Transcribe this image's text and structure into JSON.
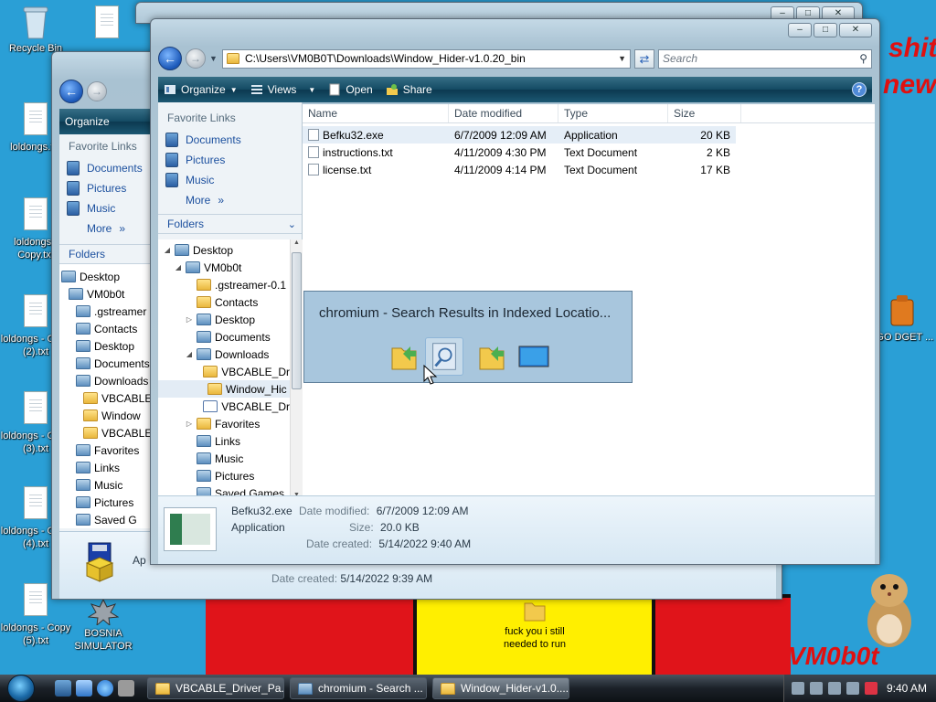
{
  "desktop": {
    "icons": [
      {
        "label": "Recycle Bin"
      },
      {
        "label": ""
      },
      {
        "label": "loldongs.txt"
      },
      {
        "label": "loldongs - Copy.txt"
      },
      {
        "label": "loldongs - Copy (2).txt"
      },
      {
        "label": "loldongs - Copy (3).txt"
      },
      {
        "label": "loldongs - Copy (4).txt"
      },
      {
        "label": "loldongs - Copy (5).txt"
      },
      {
        "label": "BOSNIA SIMULATOR"
      },
      {
        "label": "fuck you i still needed to run"
      },
      {
        "label": "O GO DGET ..."
      }
    ],
    "wallpaper_text": [
      "shit",
      "new",
      "VM0b0t"
    ]
  },
  "back_window": {
    "organize": "Organize",
    "favorite_links_title": "Favorite Links",
    "favorites": [
      "Documents",
      "Pictures",
      "Music"
    ],
    "more": "More",
    "folders_title": "Folders",
    "tree": [
      "Desktop",
      "VM0b0t",
      ".gstreamer",
      "Contacts",
      "Desktop",
      "Documents",
      "Downloads",
      "VBCABLE",
      "Window",
      "VBCABLE",
      "Favorites",
      "Links",
      "Music",
      "Pictures",
      "Saved G"
    ],
    "details_fragment": "Ap",
    "date_created_label": "Date created:",
    "date_created_value": "5/14/2022 9:39 AM"
  },
  "main_window": {
    "address": "C:\\Users\\VM0B0T\\Downloads\\Window_Hider-v1.0.20_bin",
    "search_placeholder": "Search",
    "toolbar": {
      "organize": "Organize",
      "views": "Views",
      "open": "Open",
      "share": "Share"
    },
    "favorite_links_title": "Favorite Links",
    "favorites": [
      "Documents",
      "Pictures",
      "Music"
    ],
    "more": "More",
    "folders_title": "Folders",
    "tree": [
      {
        "label": "Desktop",
        "level": 0,
        "expand": "open",
        "icon": "blue"
      },
      {
        "label": "VM0b0t",
        "level": 1,
        "expand": "open",
        "icon": "blue"
      },
      {
        "label": ".gstreamer-0.1",
        "level": 2,
        "expand": "",
        "icon": "folder"
      },
      {
        "label": "Contacts",
        "level": 2,
        "expand": "",
        "icon": "folder"
      },
      {
        "label": "Desktop",
        "level": 2,
        "expand": "closed",
        "icon": "blue"
      },
      {
        "label": "Documents",
        "level": 2,
        "expand": "",
        "icon": "blue"
      },
      {
        "label": "Downloads",
        "level": 2,
        "expand": "open",
        "icon": "blue"
      },
      {
        "label": "VBCABLE_Dr",
        "level": 3,
        "expand": "",
        "icon": "folder"
      },
      {
        "label": "Window_Hic",
        "level": 3,
        "expand": "",
        "icon": "folder",
        "selected": true
      },
      {
        "label": "VBCABLE_Dr",
        "level": 3,
        "expand": "",
        "icon": "zip"
      },
      {
        "label": "Favorites",
        "level": 2,
        "expand": "closed",
        "icon": "folder"
      },
      {
        "label": "Links",
        "level": 2,
        "expand": "",
        "icon": "blue"
      },
      {
        "label": "Music",
        "level": 2,
        "expand": "",
        "icon": "blue"
      },
      {
        "label": "Pictures",
        "level": 2,
        "expand": "",
        "icon": "blue"
      },
      {
        "label": "Saved Games",
        "level": 2,
        "expand": "",
        "icon": "blue"
      }
    ],
    "columns": [
      "Name",
      "Date modified",
      "Type",
      "Size"
    ],
    "files": [
      {
        "name": "Befku32.exe",
        "date": "6/7/2009 12:09 AM",
        "type": "Application",
        "size": "20 KB"
      },
      {
        "name": "instructions.txt",
        "date": "4/11/2009 4:30 PM",
        "type": "Text Document",
        "size": "2 KB"
      },
      {
        "name": "license.txt",
        "date": "4/11/2009 4:14 PM",
        "type": "Text Document",
        "size": "17 KB"
      }
    ],
    "details": {
      "name": "Befku32.exe",
      "kind": "Application",
      "date_modified_label": "Date modified:",
      "date_modified": "6/7/2009 12:09 AM",
      "size_label": "Size:",
      "size": "20.0 KB",
      "date_created_label": "Date created:",
      "date_created": "5/14/2022 9:40 AM"
    }
  },
  "switcher": {
    "title": "chromium - Search Results in Indexed Locatio..."
  },
  "taskbar": {
    "buttons": [
      "VBCABLE_Driver_Pa...",
      "chromium - Search ...",
      "Window_Hider-v1.0...."
    ],
    "clock": "9:40 AM"
  },
  "colors": {
    "desktop": "#2a9fd6",
    "cmdbar": "#134a63",
    "link": "#1b4f9e"
  }
}
